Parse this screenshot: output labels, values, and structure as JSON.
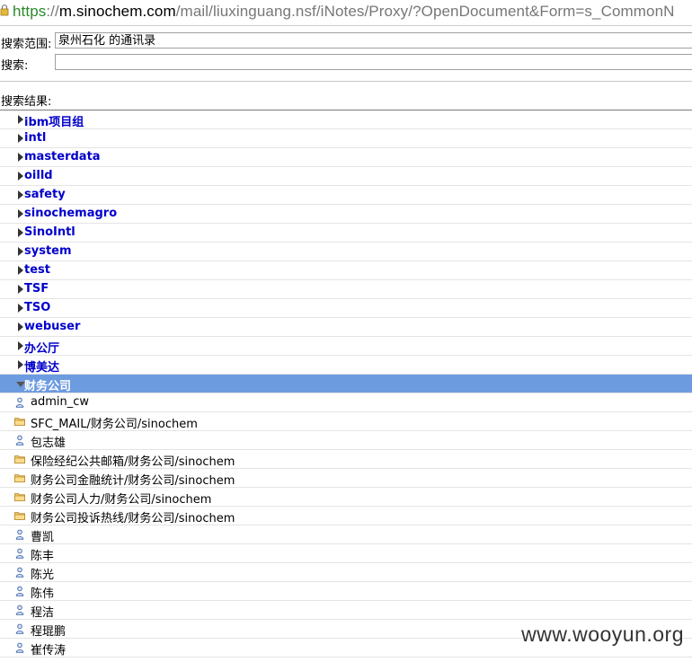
{
  "browser": {
    "url_scheme": "https",
    "url_sep": "://",
    "url_host": "m.sinochem.com",
    "url_path": "/mail/liuxinguang.nsf/iNotes/Proxy/?OpenDocument&Form=s_CommonN"
  },
  "form": {
    "scope_label": "搜索范围:",
    "scope_value": "泉州石化 的通讯录",
    "search_label": "搜索:",
    "search_value": ""
  },
  "results_label": "搜索结果:",
  "groups": [
    "ibm项目组",
    "intl",
    "masterdata",
    "oilld",
    "safety",
    "sinochemagro",
    "SinoIntl",
    "system",
    "test",
    "TSF",
    "TSO",
    "webuser",
    "办公厅",
    "博美达"
  ],
  "expanded_group": "财务公司",
  "entries": [
    {
      "icon": "person-icon",
      "label": "admin_cw"
    },
    {
      "icon": "folder-icon",
      "label": "SFC_MAIL/财务公司/sinochem"
    },
    {
      "icon": "person-icon",
      "label": "包志雄"
    },
    {
      "icon": "folder-icon",
      "label": "保险经纪公共邮箱/财务公司/sinochem"
    },
    {
      "icon": "folder-icon",
      "label": "财务公司金融统计/财务公司/sinochem"
    },
    {
      "icon": "folder-icon",
      "label": "财务公司人力/财务公司/sinochem"
    },
    {
      "icon": "folder-icon",
      "label": "财务公司投诉热线/财务公司/sinochem"
    },
    {
      "icon": "person-icon",
      "label": "曹凯"
    },
    {
      "icon": "person-icon",
      "label": "陈丰"
    },
    {
      "icon": "person-icon",
      "label": "陈光"
    },
    {
      "icon": "person-icon",
      "label": "陈伟"
    },
    {
      "icon": "person-icon",
      "label": "程洁"
    },
    {
      "icon": "person-icon",
      "label": "程琨鹏"
    },
    {
      "icon": "person-icon",
      "label": "崔传涛"
    }
  ],
  "watermark": "www.wooyun.org",
  "colors": {
    "link": "#0000cc",
    "selected_row": "#6d9be0",
    "url_https": "#2a8a2a"
  }
}
